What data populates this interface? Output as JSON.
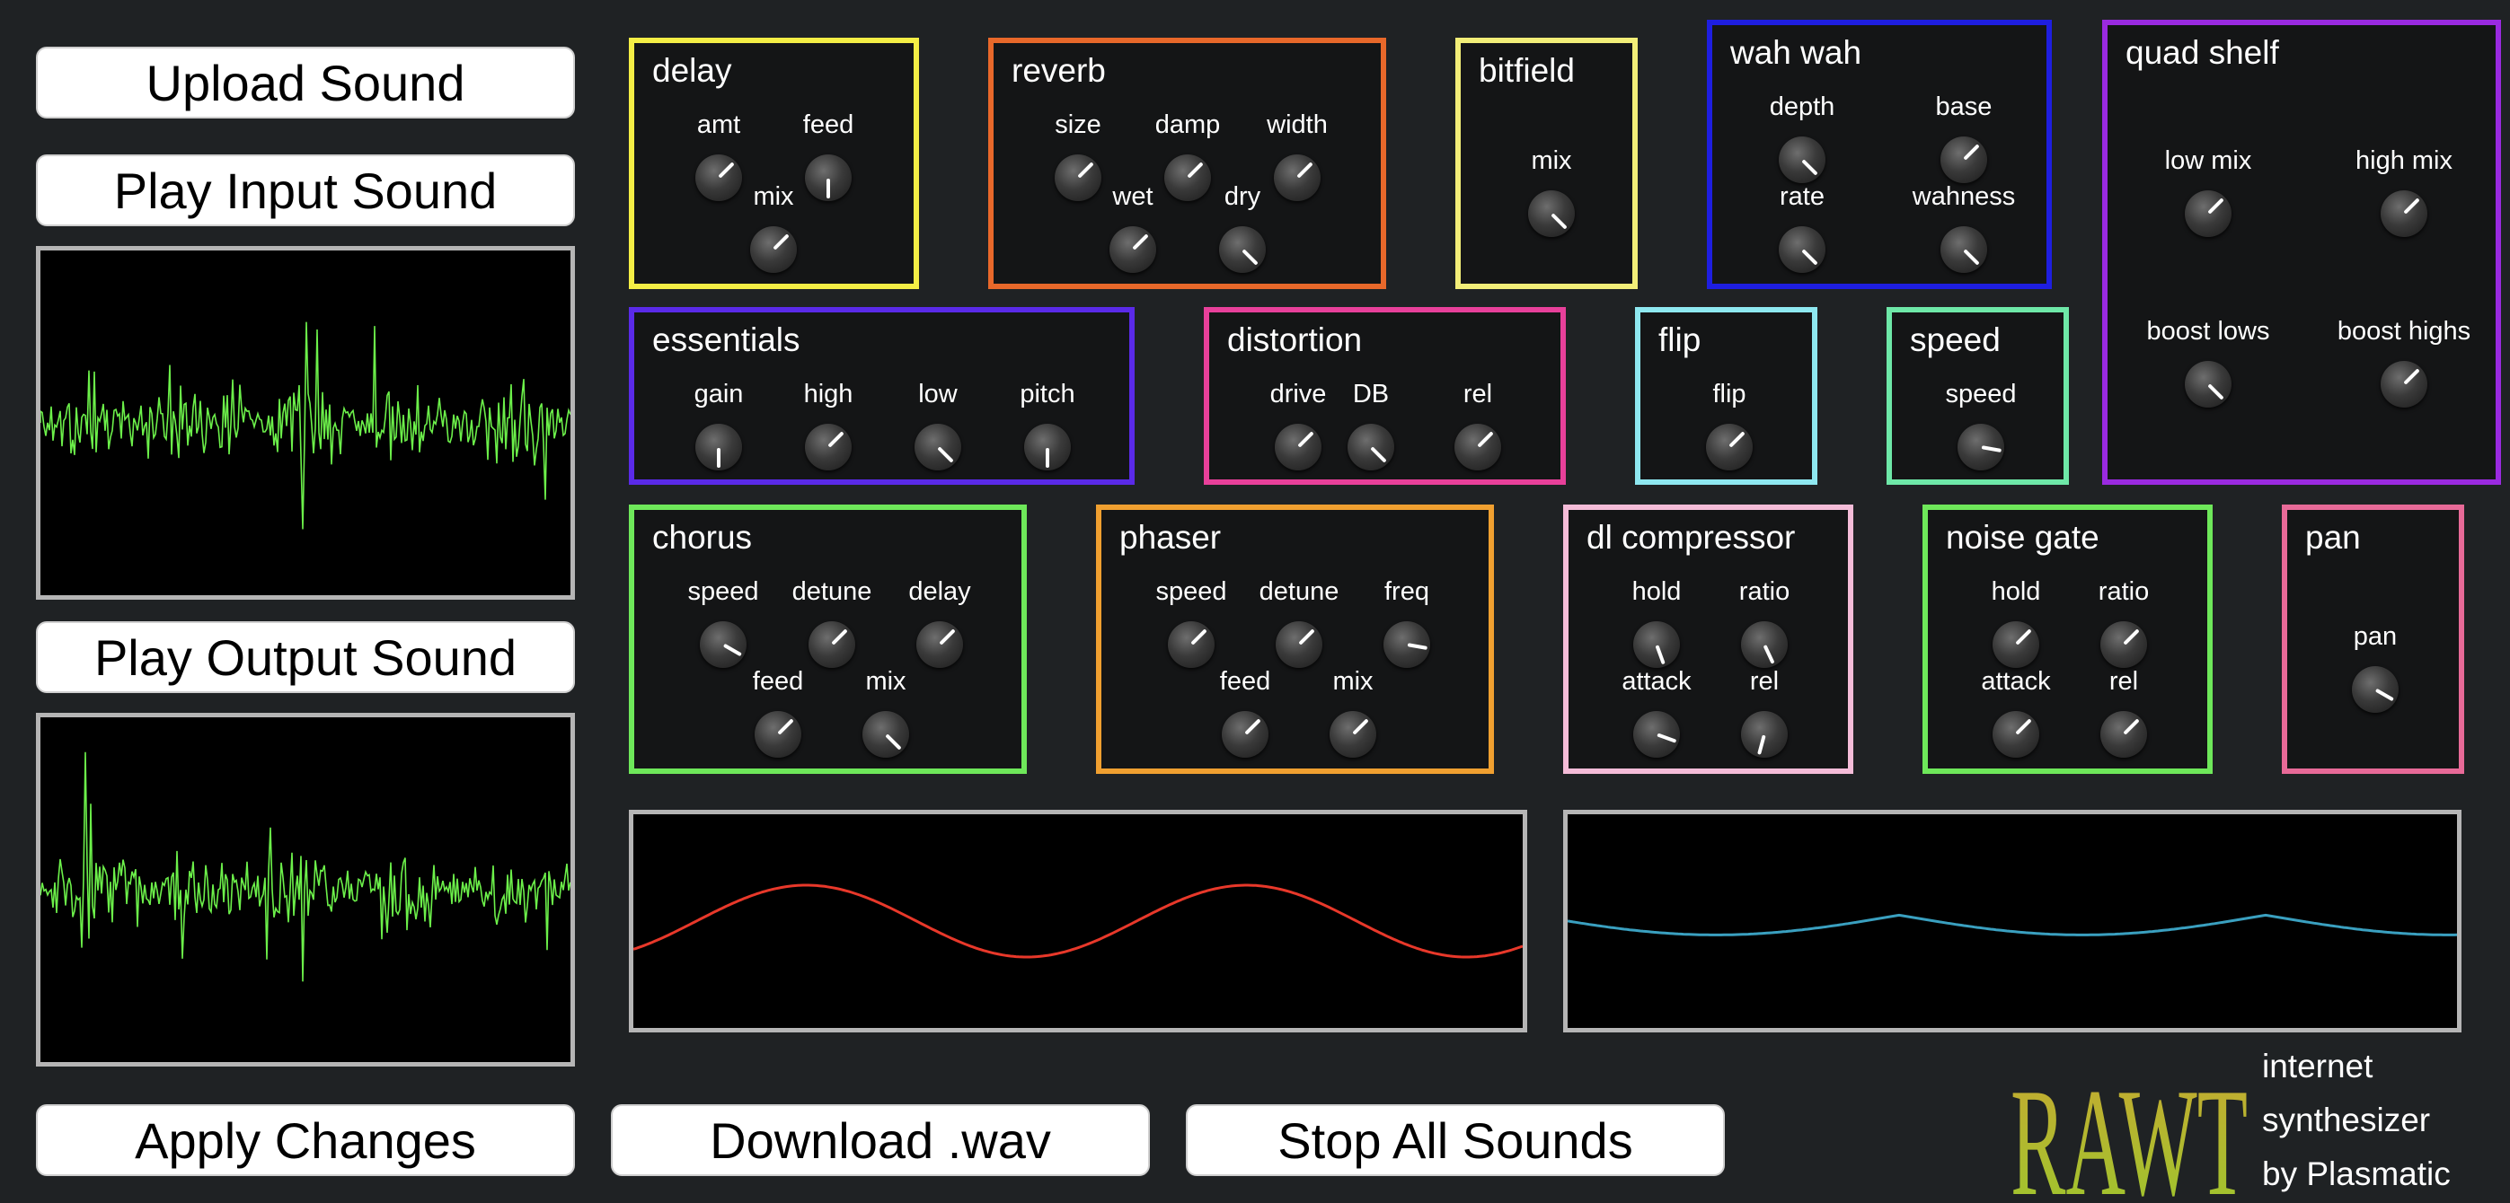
{
  "buttons": {
    "upload": "Upload Sound",
    "play_input": "Play Input Sound",
    "play_output": "Play Output Sound",
    "apply": "Apply Changes",
    "download": "Download .wav",
    "stop": "Stop All Sounds"
  },
  "panels": {
    "delay": {
      "title": "delay",
      "color": "#f4ee45",
      "knobs": {
        "amt": "amt",
        "feed": "feed",
        "mix": "mix"
      }
    },
    "reverb": {
      "title": "reverb",
      "color": "#e8682a",
      "knobs": {
        "size": "size",
        "damp": "damp",
        "width": "width",
        "wet": "wet",
        "dry": "dry"
      }
    },
    "bitfield": {
      "title": "bitfield",
      "color": "#f2ee78",
      "knobs": {
        "mix": "mix"
      }
    },
    "wahwah": {
      "title": "wah wah",
      "color": "#1e1ee0",
      "knobs": {
        "depth": "depth",
        "base": "base",
        "rate": "rate",
        "wahness": "wahness"
      }
    },
    "quadshelf": {
      "title": "quad shelf",
      "color": "#9a2ae0",
      "knobs": {
        "low_mix": "low mix",
        "high_mix": "high mix",
        "boost_lows": "boost lows",
        "boost_highs": "boost highs"
      }
    },
    "essentials": {
      "title": "essentials",
      "color": "#5a2ae8",
      "knobs": {
        "gain": "gain",
        "high": "high",
        "low": "low",
        "pitch": "pitch"
      }
    },
    "distortion": {
      "title": "distortion",
      "color": "#e8409a",
      "knobs": {
        "drive": "drive",
        "db": "DB",
        "rel": "rel"
      }
    },
    "flip": {
      "title": "flip",
      "color": "#8ee8f0",
      "knobs": {
        "flip": "flip"
      }
    },
    "speed": {
      "title": "speed",
      "color": "#6ee8a8",
      "knobs": {
        "speed": "speed"
      }
    },
    "chorus": {
      "title": "chorus",
      "color": "#6ee85a",
      "knobs": {
        "speed": "speed",
        "detune": "detune",
        "delay": "delay",
        "feed": "feed",
        "mix": "mix"
      }
    },
    "phaser": {
      "title": "phaser",
      "color": "#f0a030",
      "knobs": {
        "speed": "speed",
        "detune": "detune",
        "freq": "freq",
        "feed": "feed",
        "mix": "mix"
      }
    },
    "compressor": {
      "title": "dl compressor",
      "color": "#f4bcd8",
      "knobs": {
        "hold": "hold",
        "ratio": "ratio",
        "attack": "attack",
        "rel": "rel"
      }
    },
    "noisegate": {
      "title": "noise gate",
      "color": "#6ee85a",
      "knobs": {
        "hold": "hold",
        "ratio": "ratio",
        "attack": "attack",
        "rel": "rel"
      }
    },
    "pan": {
      "title": "pan",
      "color": "#e86a98",
      "knobs": {
        "pan": "pan"
      }
    }
  },
  "colors": {
    "input_wave": "#6cf04a",
    "output_wave": "#6cf04a",
    "red_wave": "#e8382a",
    "cyan_wave": "#3aa0c0",
    "logo": "#b8c832"
  },
  "logo": {
    "text": "RAWT",
    "line1": "internet",
    "line2": "synthesizer",
    "line3": "by Plasmatic"
  }
}
